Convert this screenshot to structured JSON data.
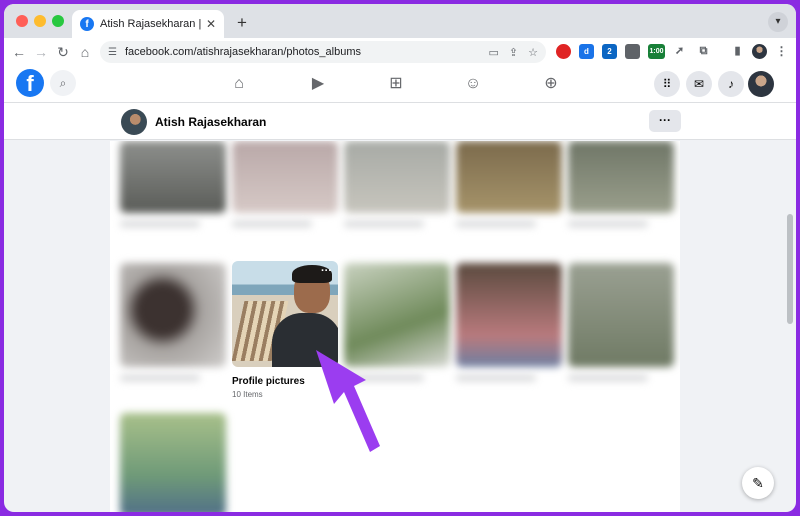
{
  "browser": {
    "tab_title": "Atish Rajasekharan | Facebook",
    "tab_close": "✕",
    "new_tab": "+",
    "url": "facebook.com/atishrajasekharan/photos_albums",
    "extensions": [
      {
        "icon": "opera-icon",
        "color": "#e02424",
        "label": ""
      },
      {
        "icon": "dashlane-icon",
        "color": "#1a73e8",
        "label": "d"
      },
      {
        "icon": "trello-icon",
        "color": "#0b66c3",
        "label": "2"
      },
      {
        "icon": "incognito-extension-icon",
        "color": "#5f6368",
        "label": ""
      },
      {
        "icon": "timer-extension-icon",
        "color": "#188038",
        "label": "1:00"
      },
      {
        "icon": "lightning-icon",
        "color": "#5f6368",
        "label": ""
      },
      {
        "icon": "puzzle-icon",
        "color": "#5f6368",
        "label": ""
      }
    ]
  },
  "facebook": {
    "logo": "f",
    "profile_name": "Atish Rajasekharan",
    "more_label": "···"
  },
  "album": {
    "name": "Profile pictures",
    "count": "10 Items",
    "menu": "···"
  },
  "colors": {
    "accent": "#1877f2",
    "arrow": "#9b3df0"
  }
}
